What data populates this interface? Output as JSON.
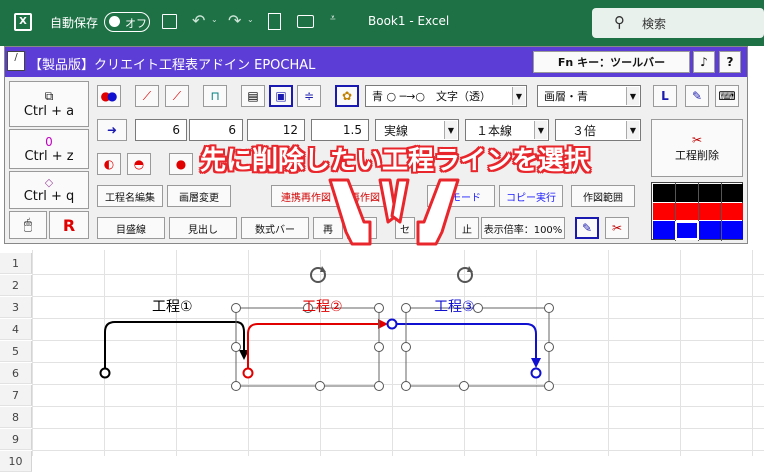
{
  "titlebar": {
    "autosave_label": "自動保存",
    "autosave_state": "オフ",
    "doc_title": "Book1  -  Excel",
    "search_label": "検索"
  },
  "addin": {
    "title": "【製品版】クリエイト工程表アドイン EPOCHAL",
    "fn_button": "Fn キー：ツールバー",
    "music_button": "♪",
    "help_button": "?"
  },
  "left_buttons": {
    "ctrl_a": "Ctrl + a",
    "ctrl_z": "Ctrl + z",
    "ctrl_z_top": "0",
    "ctrl_q": "Ctrl + q"
  },
  "row1": {
    "color_text_select": "青 ○ ─→○　文字（透）",
    "layer_select": "画層・青"
  },
  "row2": {
    "v1": "6",
    "v2": "6",
    "v3": "12",
    "v4": "1.5",
    "line_style": "実線",
    "line_count": "１本線",
    "scale": "３倍",
    "delete_label": "工程削除"
  },
  "row4": {
    "b1": "工程名編集",
    "b2": "画層変更",
    "b3": "連携再作図",
    "b4": "再作図",
    "b5": "ーモード",
    "b6": "コピー実行",
    "b7": "作図範囲"
  },
  "row5": {
    "b1": "目盛線",
    "b2": "見出し",
    "b3": "数式バー",
    "b4": "再",
    "b5": "動",
    "b6": "セ",
    "b7": "止",
    "b8": "表示倍率：100%"
  },
  "callout": "先に削除したい工程ラインを選択",
  "rows": [
    "1",
    "2",
    "3",
    "4",
    "5",
    "6",
    "7",
    "8",
    "9",
    "10"
  ],
  "diagram": {
    "label1": "工程①",
    "label2": "工程②",
    "label3": "工程③"
  },
  "colors": {
    "excel_green": "#1e7145",
    "header_purple": "#5c3ed6",
    "callout_red": "#e8262b",
    "line_black": "#000000",
    "line_red": "#e00000",
    "line_blue": "#1010d0"
  }
}
